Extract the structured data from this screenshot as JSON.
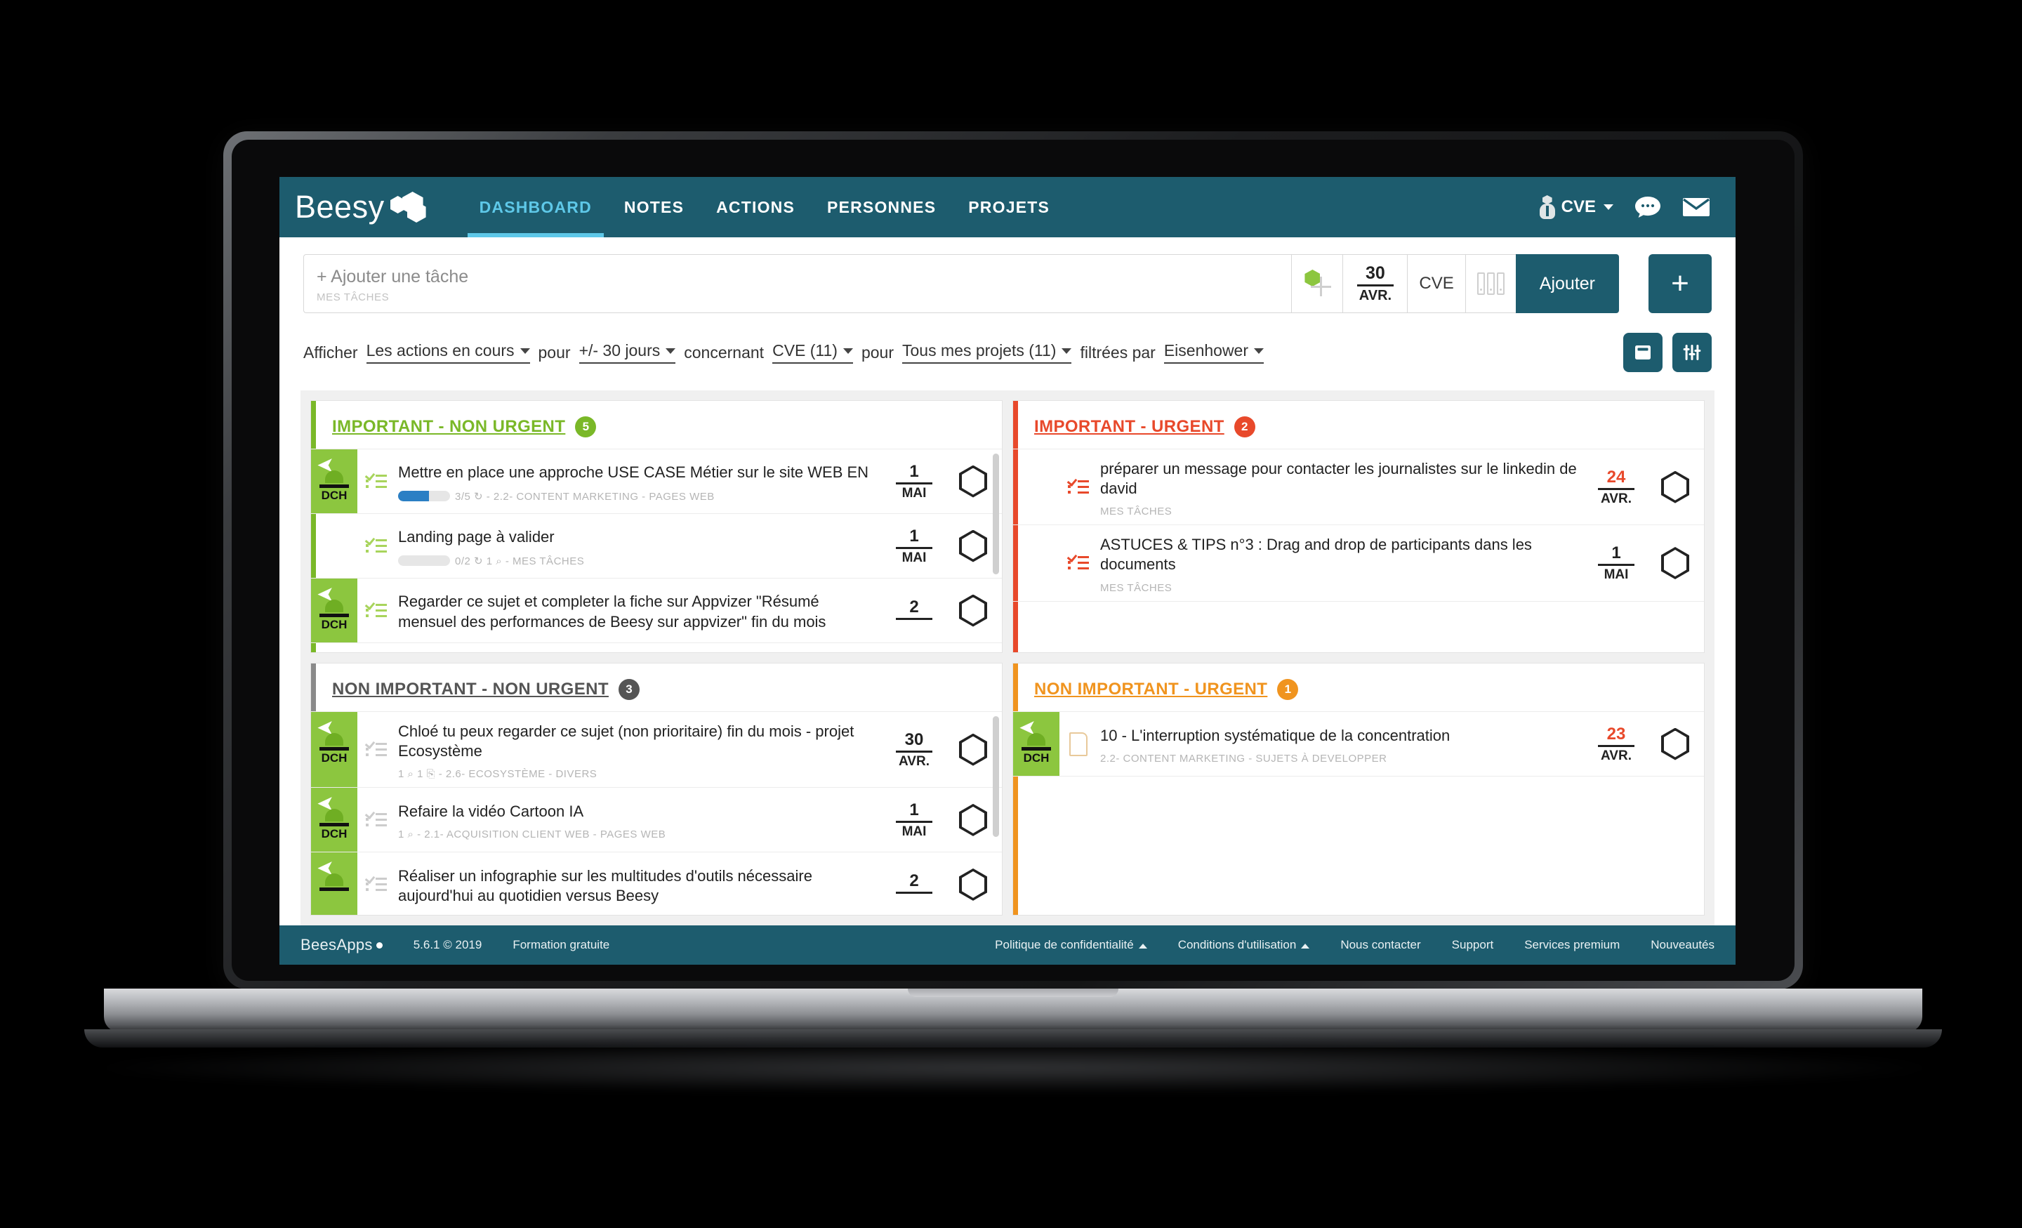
{
  "header": {
    "brand": "Beesy",
    "nav": [
      {
        "label": "DASHBOARD",
        "active": true
      },
      {
        "label": "NOTES",
        "active": false
      },
      {
        "label": "ACTIONS",
        "active": false
      },
      {
        "label": "PERSONNES",
        "active": false
      },
      {
        "label": "PROJETS",
        "active": false
      }
    ],
    "user": "CVE",
    "accent_color": "#1d5c6e",
    "active_color": "#5ec8e8"
  },
  "add_task": {
    "placeholder": "+ Ajouter une tâche",
    "scope_label": "MES TÂCHES",
    "date_day": "30",
    "date_month": "AVR.",
    "assignee": "CVE",
    "button_label": "Ajouter",
    "plus_label": "+"
  },
  "filters": {
    "afficher_label": "Afficher",
    "actions_select": "Les actions en cours",
    "pour_label_1": "pour",
    "period_select": "+/- 30 jours",
    "concernant_label": "concernant",
    "person_select": "CVE (11)",
    "pour_label_2": "pour",
    "projects_select": "Tous mes projets (11)",
    "filtrees_label": "filtrées par",
    "matrix_select": "Eisenhower"
  },
  "quadrants": [
    {
      "title": "IMPORTANT - NON URGENT",
      "count": "5",
      "color": "#7ab828",
      "accent": "#7ab828",
      "tasks": [
        {
          "title": "Mettre en place une approche USE CASE Métier sur le site WEB EN",
          "meta": "3/5 ↻ - 2.2- CONTENT MARKETING - PAGES WEB",
          "progress_label": "3/5",
          "progress_pct": 60,
          "has_progress": true,
          "avatar": "DCH",
          "has_avatar": true,
          "icon": "checklist-icon",
          "icon_color": "#a8d45c",
          "day": "1",
          "month": "MAI",
          "day_color": "#222222"
        },
        {
          "title": "Landing page à valider",
          "meta": "0/2 ↻ 1 ⌕ - MES TÂCHES",
          "progress_label": "0/2",
          "progress_pct": 0,
          "has_progress": true,
          "avatar": "",
          "has_avatar": false,
          "icon": "checklist-icon",
          "icon_color": "#a8d45c",
          "day": "1",
          "month": "MAI",
          "day_color": "#222222"
        },
        {
          "title": "Regarder ce sujet et completer la fiche sur Appvizer \"Résumé mensuel des performances de Beesy sur appvizer\" fin du mois",
          "meta": "",
          "progress_label": "",
          "progress_pct": 0,
          "has_progress": false,
          "avatar": "DCH",
          "has_avatar": true,
          "icon": "checklist-icon",
          "icon_color": "#a8d45c",
          "day": "2",
          "month": "",
          "day_color": "#222222"
        }
      ]
    },
    {
      "title": "IMPORTANT - URGENT",
      "count": "2",
      "color": "#e8492b",
      "accent": "#e8492b",
      "tasks": [
        {
          "title": "préparer un message pour contacter les journalistes sur le linkedin de david",
          "meta": "MES TÂCHES",
          "progress_label": "",
          "progress_pct": 0,
          "has_progress": false,
          "avatar": "",
          "has_avatar": false,
          "icon": "checklist-icon",
          "icon_color": "#e8492b",
          "day": "24",
          "month": "AVR.",
          "day_color": "#e8492b"
        },
        {
          "title": "ASTUCES & TIPS n°3 : Drag and drop de participants dans les documents",
          "meta": "MES TÂCHES",
          "progress_label": "",
          "progress_pct": 0,
          "has_progress": false,
          "avatar": "",
          "has_avatar": false,
          "icon": "checklist-icon",
          "icon_color": "#e8492b",
          "day": "1",
          "month": "MAI",
          "day_color": "#222222"
        }
      ]
    },
    {
      "title": "NON IMPORTANT - NON URGENT",
      "count": "3",
      "color": "#555555",
      "accent": "#8a8a8a",
      "tasks": [
        {
          "title": "Chloé tu peux regarder ce sujet (non prioritaire) fin du mois - projet Ecosystème",
          "meta": "1 ⌕ 1 ⎘ - 2.6- ECOSYSTÈME - DIVERS",
          "progress_label": "",
          "progress_pct": 0,
          "has_progress": false,
          "avatar": "DCH",
          "has_avatar": true,
          "icon": "checklist-icon",
          "icon_color": "#cccccc",
          "day": "30",
          "month": "AVR.",
          "day_color": "#222222"
        },
        {
          "title": "Refaire la vidéo Cartoon IA",
          "meta": "1 ⌕ - 2.1- ACQUISITION CLIENT WEB - PAGES WEB",
          "progress_label": "",
          "progress_pct": 0,
          "has_progress": false,
          "avatar": "DCH",
          "has_avatar": true,
          "icon": "checklist-icon",
          "icon_color": "#cccccc",
          "day": "1",
          "month": "MAI",
          "day_color": "#222222"
        },
        {
          "title": "Réaliser un infographie sur les multitudes d'outils nécessaire aujourd'hui au quotidien versus Beesy",
          "meta": "",
          "progress_label": "",
          "progress_pct": 0,
          "has_progress": false,
          "avatar": "",
          "has_avatar": true,
          "icon": "checklist-icon",
          "icon_color": "#cccccc",
          "day": "2",
          "month": "",
          "day_color": "#222222"
        }
      ]
    },
    {
      "title": "NON IMPORTANT - URGENT",
      "count": "1",
      "color": "#f0941f",
      "accent": "#f0941f",
      "tasks": [
        {
          "title": "10 - L'interruption systématique de la concentration",
          "meta": "2.2- CONTENT MARKETING - SUJETS À DEVELOPPER",
          "progress_label": "",
          "progress_pct": 0,
          "has_progress": false,
          "avatar": "DCH",
          "has_avatar": true,
          "icon": "document-icon",
          "icon_color": "#e8c99a",
          "day": "23",
          "month": "AVR.",
          "day_color": "#e8492b"
        }
      ]
    }
  ],
  "footer": {
    "brand": "BeesApps",
    "version": "5.6.1 © 2019",
    "training": "Formation gratuite",
    "links": [
      {
        "label": "Politique de confidentialité",
        "caret": true
      },
      {
        "label": "Conditions d'utilisation",
        "caret": true
      },
      {
        "label": "Nous contacter",
        "caret": false
      },
      {
        "label": "Support",
        "caret": false
      },
      {
        "label": "Services premium",
        "caret": false
      },
      {
        "label": "Nouveautés",
        "caret": false
      }
    ]
  }
}
